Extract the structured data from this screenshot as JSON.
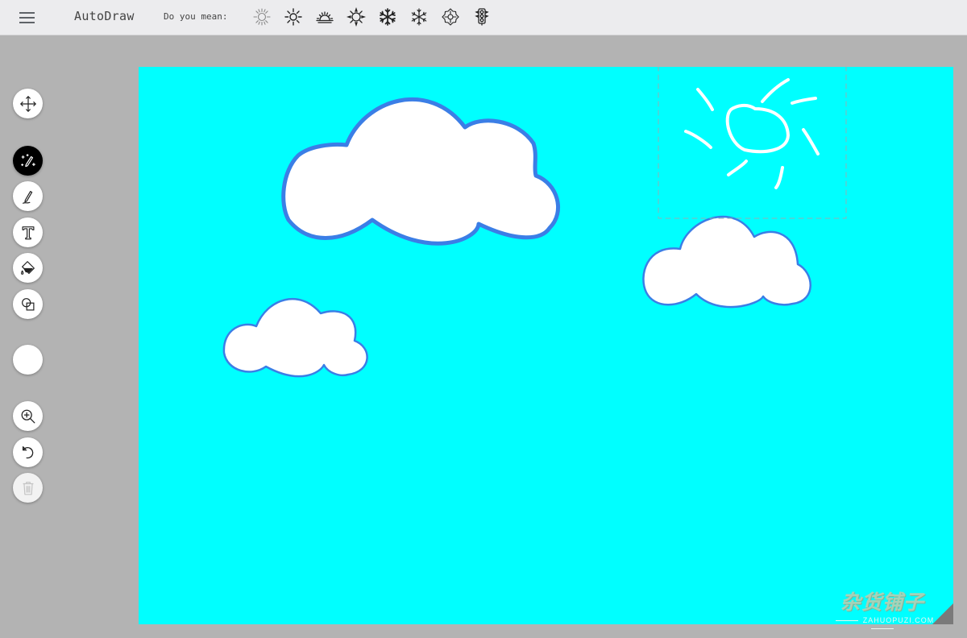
{
  "header": {
    "app_title": "AutoDraw",
    "suggest_label": "Do you mean:",
    "suggestions": [
      "sun-sketch-icon",
      "sun-icon",
      "sunset-icon",
      "sun-burst-icon",
      "snowflake-icon",
      "snowflake-thin-icon",
      "snowflake-ornate-icon",
      "traffic-light-icon"
    ]
  },
  "toolbar": {
    "tools": [
      "move-icon",
      "autodraw-icon",
      "pencil-icon",
      "text-icon",
      "fill-icon",
      "shape-icon",
      "color-swatch",
      "zoom-icon",
      "undo-icon",
      "delete-icon"
    ],
    "active_tool": "autodraw-icon",
    "disabled_tool": "delete-icon",
    "current_color": "#ffffff"
  },
  "canvas": {
    "background_color": "#00ffff",
    "cloud_fill": "#ffffff",
    "cloud_stroke": "#3b7ee6",
    "sun_stroke": "#ffffff",
    "shapes": [
      "cloud-large",
      "cloud-small",
      "cloud-right",
      "sun-sketch"
    ],
    "selection": "sun-sketch"
  },
  "watermark": {
    "title": "杂货铺子",
    "subtitle": "ZAHUOPUZI.COM"
  }
}
